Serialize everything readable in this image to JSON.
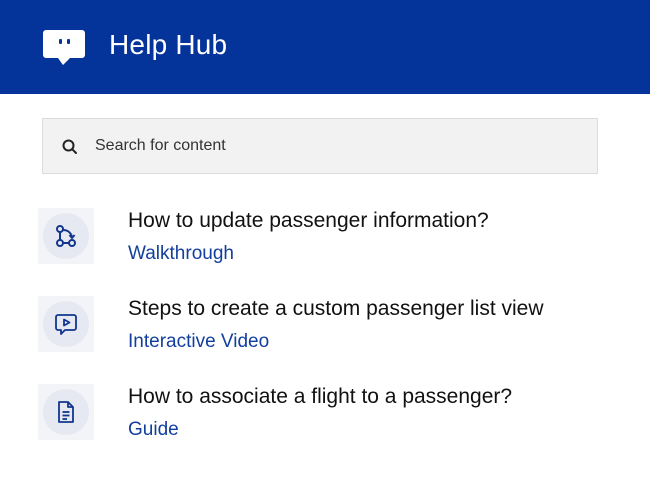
{
  "header": {
    "title": "Help Hub",
    "logo_icon": "chat-bubble-icon",
    "background_color": "#04349a"
  },
  "search": {
    "placeholder": "Search for content",
    "value": "",
    "icon": "search-icon"
  },
  "items": [
    {
      "title": "How to update passenger information?",
      "type": "Walkthrough",
      "icon": "walkthrough-flow-icon"
    },
    {
      "title": "Steps to create a custom passenger list view",
      "type": "Interactive Video",
      "icon": "video-message-icon"
    },
    {
      "title": "How to associate a flight to a passenger?",
      "type": "Guide",
      "icon": "document-icon"
    }
  ],
  "colors": {
    "accent": "#04349a",
    "link": "#123f9c",
    "icon_stroke": "#12368e"
  }
}
